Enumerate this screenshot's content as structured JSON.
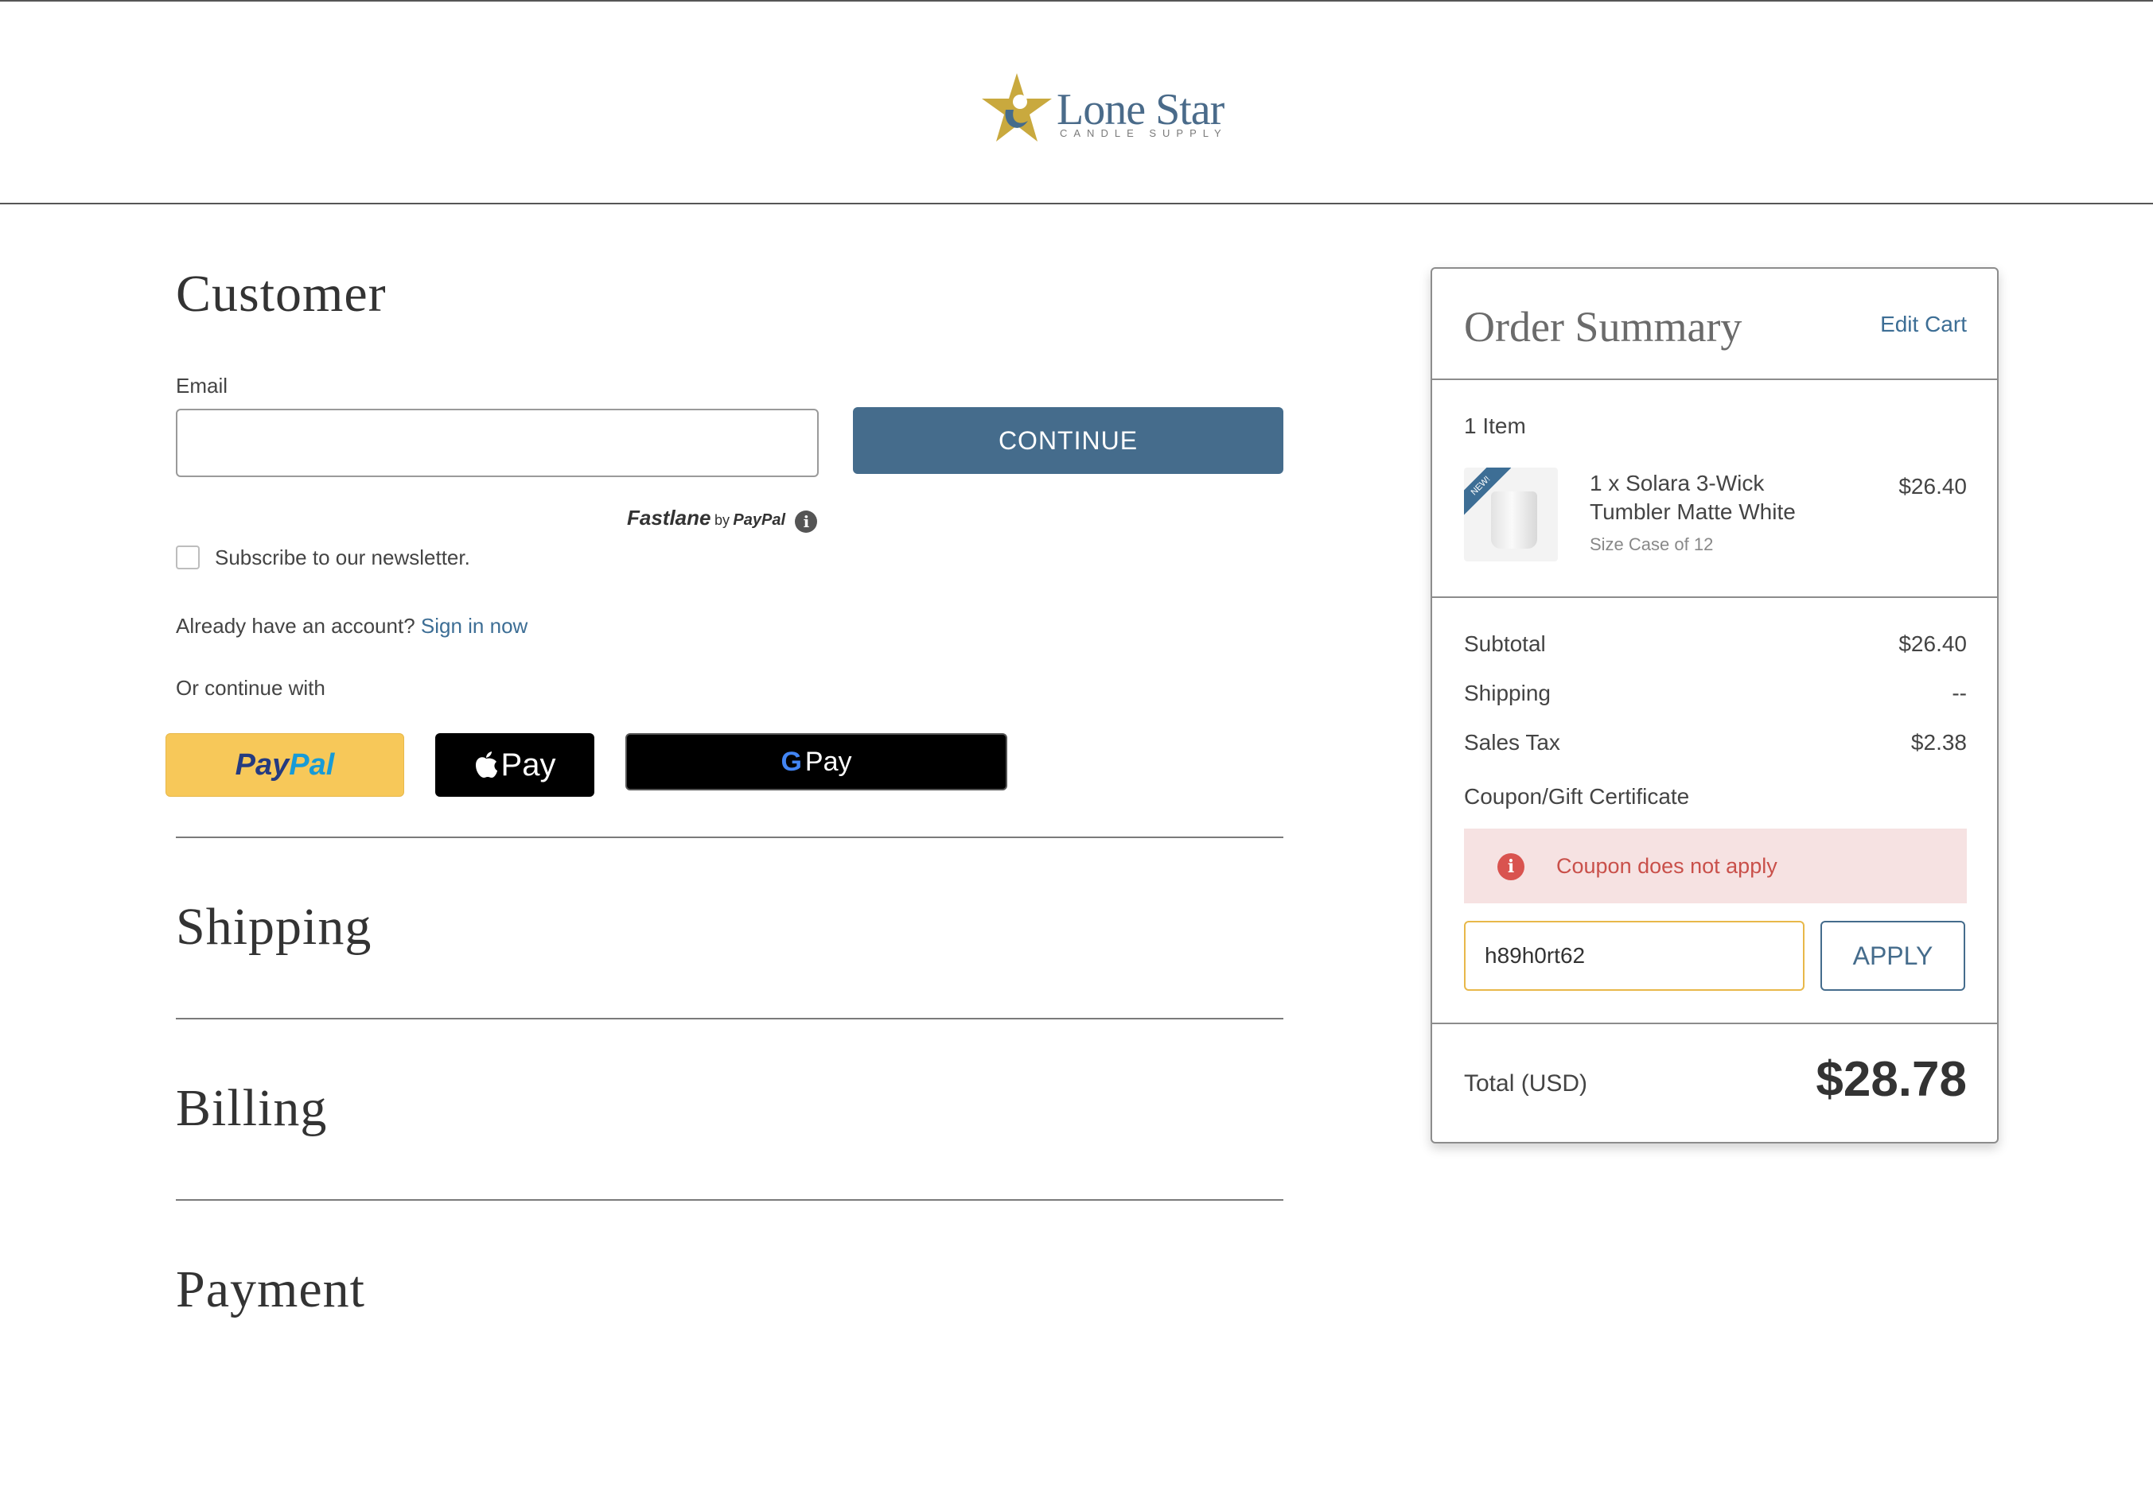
{
  "brand": {
    "name": "Lone Star",
    "tagline": "CANDLE SUPPLY"
  },
  "customer": {
    "title": "Customer",
    "email_label": "Email",
    "email_value": "",
    "continue_label": "CONTINUE",
    "fastlane": "Fastlane",
    "fastlane_by": "by",
    "fastlane_paypal": "PayPal",
    "newsletter_label": "Subscribe to our newsletter.",
    "account_prompt": "Already have an account?",
    "sign_in_link": "Sign in now",
    "or_continue": "Or continue with",
    "paypal_a": "Pay",
    "paypal_b": "Pal",
    "apple_pay": "Pay",
    "google_pay": "Pay"
  },
  "sections": {
    "shipping": "Shipping",
    "billing": "Billing",
    "payment": "Payment"
  },
  "summary": {
    "title": "Order Summary",
    "edit_cart": "Edit Cart",
    "item_count": "1 Item",
    "item": {
      "name_line1": "1 x Solara 3-Wick",
      "name_line2": "Tumbler Matte White",
      "option": "Size Case of 12",
      "price": "$26.40",
      "badge": "NEW!"
    },
    "subtotal_label": "Subtotal",
    "subtotal_value": "$26.40",
    "shipping_label": "Shipping",
    "shipping_value": "--",
    "tax_label": "Sales Tax",
    "tax_value": "$2.38",
    "coupon_label": "Coupon/Gift Certificate",
    "coupon_error": "Coupon does not apply",
    "coupon_value": "h89h0rt62",
    "apply_label": "APPLY",
    "total_label": "Total (USD)",
    "total_value": "$28.78"
  },
  "colors": {
    "accent": "#456c8c",
    "link": "#3d6e95",
    "paypal_yellow": "#f7c859",
    "error_bg": "#f6e2e2",
    "error_text": "#c9504a",
    "coupon_border": "#e8b84a"
  },
  "icons": [
    "lone-star-logo-icon",
    "info-icon",
    "apple-icon",
    "google-g-icon",
    "error-icon"
  ]
}
